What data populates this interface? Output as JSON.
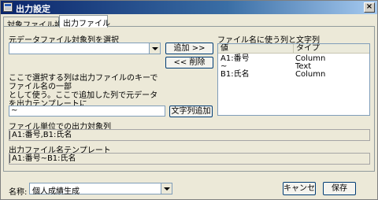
{
  "window": {
    "title": "出力設定"
  },
  "tabs": [
    {
      "label": "対象ファイル設定"
    },
    {
      "label": "出力ファイル"
    }
  ],
  "left": {
    "select_label": "元データファイル対象列を選択",
    "add_button": "追加 >>",
    "delete_button": "<< 削除",
    "description": "ここで選択する列は出力ファイルのキーでファイル名の一部\nとして使う。ここで追加した列で元データを出力テンプレートに\n基づき複数のファイルに分割する。",
    "text_input_value": "~",
    "add_text_button": "文字列追加"
  },
  "right": {
    "list_label": "ファイル名に使う列と文字列",
    "columns": [
      "値",
      "タイプ"
    ],
    "rows": [
      {
        "value": "A1:番号",
        "type": "Column"
      },
      {
        "value": "~",
        "type": "Text"
      },
      {
        "value": "B1:氏名",
        "type": "Column"
      }
    ]
  },
  "output_columns": {
    "label": "ファイル単位での出力対象列",
    "value": "A1:番号,B1:氏名"
  },
  "output_template": {
    "label": "出力ファイル名テンプレート",
    "value": "A1:番号~B1:氏名"
  },
  "footer": {
    "name_label": "名称:",
    "name_value": "個人成績生成",
    "cancel_button": "キャンセ",
    "save_button": "保存"
  }
}
